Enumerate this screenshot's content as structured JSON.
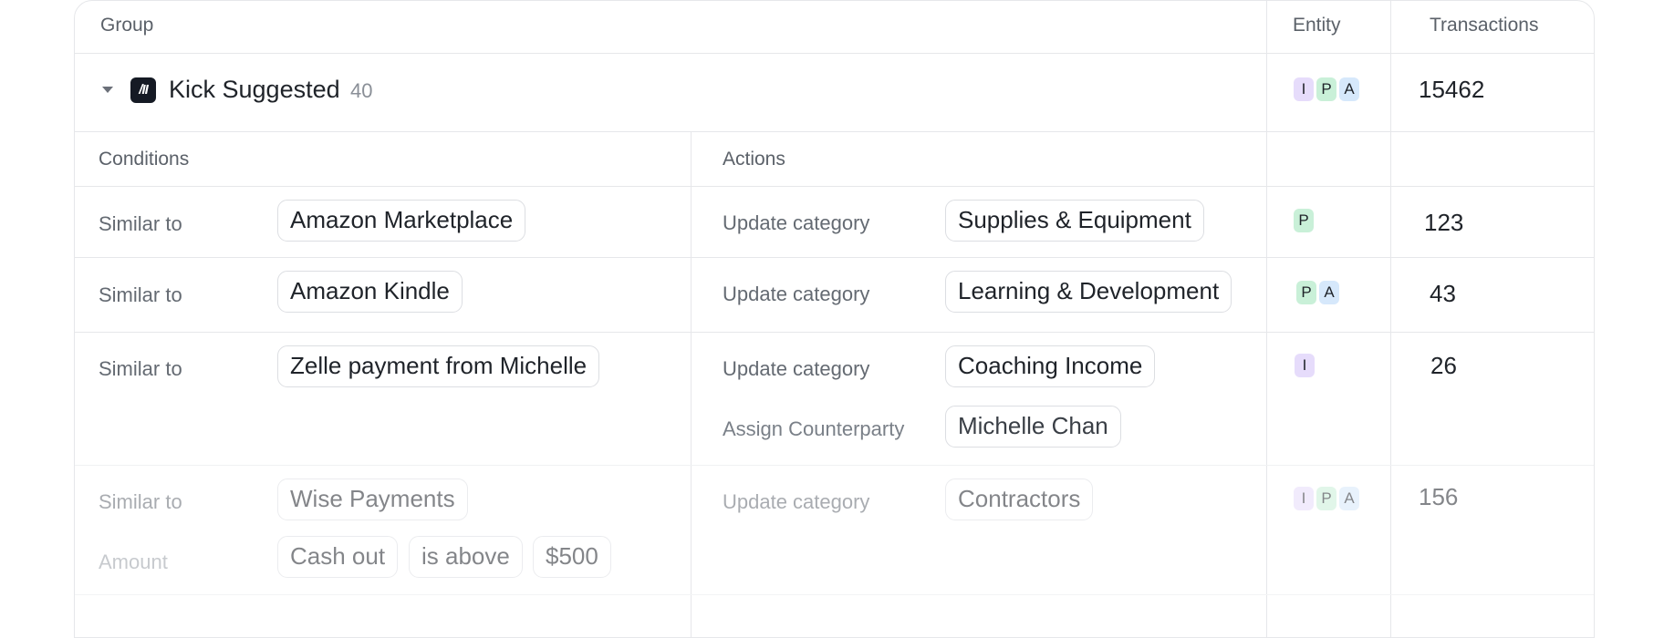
{
  "header": {
    "group": "Group",
    "entity": "Entity",
    "transactions": "Transactions"
  },
  "group": {
    "name": "Kick Suggested",
    "count": "40",
    "logo_text": "/II",
    "entity_badges": [
      "I",
      "P",
      "A"
    ],
    "transactions": "15462"
  },
  "subheader": {
    "conditions": "Conditions",
    "actions": "Actions"
  },
  "rules": [
    {
      "condition_label": "Similar to",
      "condition_value": "Amazon Marketplace",
      "action_label": "Update category",
      "action_value": "Supplies & Equipment",
      "entities": [
        "P"
      ],
      "transactions": "123"
    },
    {
      "condition_label": "Similar to",
      "condition_value": "Amazon Kindle",
      "action_label": "Update category",
      "action_value": "Learning & Development",
      "entities": [
        "P",
        "A"
      ],
      "transactions": "43"
    },
    {
      "condition_label": "Similar to",
      "condition_value": "Zelle payment from Michelle",
      "action_label": "Update category",
      "action_value": "Coaching Income",
      "action2_label": "Assign Counterparty",
      "action2_value": "Michelle Chan",
      "entities": [
        "I"
      ],
      "transactions": "26"
    },
    {
      "condition_label": "Similar to",
      "condition_value": "Wise Payments",
      "condition2_label": "Amount",
      "condition2_values": [
        "Cash out",
        "is above",
        "$500"
      ],
      "action_label": "Update category",
      "action_value": "Contractors",
      "entities": [
        "I",
        "P",
        "A"
      ],
      "transactions": "156"
    }
  ],
  "colors": {
    "badge_I": "#e6dcfb",
    "badge_P": "#c9f0d8",
    "badge_A": "#d6e8fb",
    "border": "#e6e7ea"
  },
  "icons": {
    "expand": "caret-down-icon",
    "group_logo": "kick-logo-icon"
  }
}
